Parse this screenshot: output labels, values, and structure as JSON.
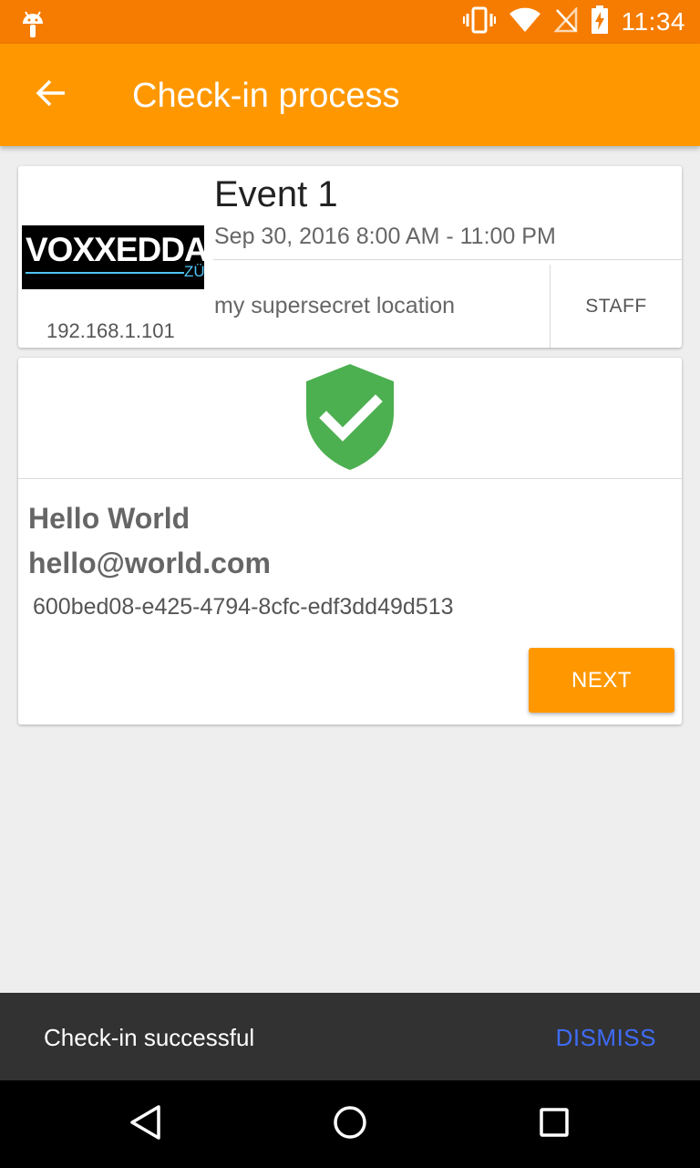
{
  "status_bar": {
    "time": "11:34",
    "icons": [
      "android-debug-icon",
      "vibrate-icon",
      "wifi-icon",
      "no-signal-icon",
      "battery-charging-icon"
    ]
  },
  "app_bar": {
    "title": "Check-in process",
    "back_icon": "arrow-back-icon"
  },
  "event": {
    "logo_text": "VOXXEDDA",
    "logo_subtext": "ZÜ",
    "ip": "192.168.1.101",
    "name": "Event 1",
    "date": "Sep 30, 2016 8:00 AM - 11:00 PM",
    "location": "my supersecret location",
    "role": "STAFF"
  },
  "attendee": {
    "status_icon": "shield-check-icon",
    "status_color": "#4caf50",
    "name": "Hello World",
    "email": "hello@world.com",
    "id": "600bed08-e425-4794-8cfc-edf3dd49d513",
    "next_label": "NEXT"
  },
  "snackbar": {
    "message": "Check-in successful",
    "action": "DISMISS"
  },
  "colors": {
    "primary": "#ff9800",
    "primary_dark": "#f57c00",
    "snackbar_action": "#3f6cf6"
  }
}
